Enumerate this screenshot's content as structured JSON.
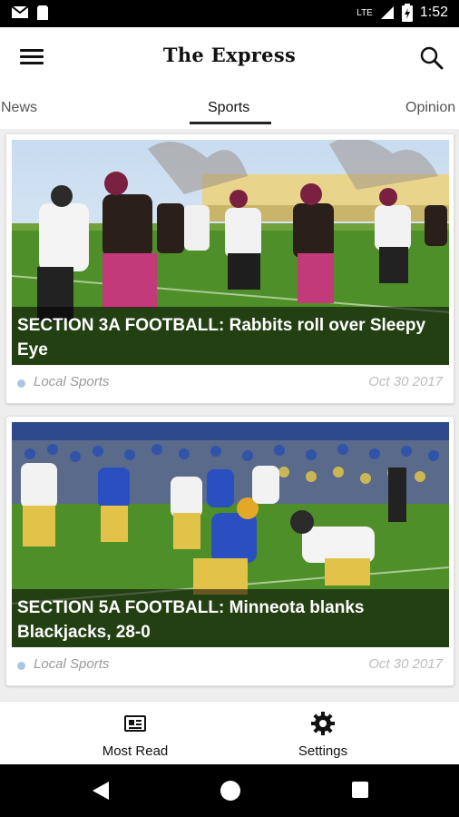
{
  "status_bar": {
    "time": "1:52",
    "network": "LTE",
    "icons": [
      "gmail-icon",
      "sim-icon",
      "signal-icon",
      "battery-icon"
    ]
  },
  "app_bar": {
    "title": "The Express",
    "menu_icon": "hamburger-menu-icon",
    "search_icon": "search-icon"
  },
  "tabs": [
    {
      "label": "News",
      "active": false
    },
    {
      "label": "Sports",
      "active": true
    },
    {
      "label": "Opinion",
      "active": false
    }
  ],
  "articles": [
    {
      "headline": "SECTION 3A FOOTBALL: Rabbits roll over Sleepy Eye",
      "category": "Local Sports",
      "date": "Oct 30 2017"
    },
    {
      "headline": "SECTION 5A FOOTBALL: Minneota blanks Blackjacks, 28-0",
      "category": "Local Sports",
      "date": "Oct 30 2017"
    }
  ],
  "bottom_nav": [
    {
      "label": "Most Read",
      "icon": "newspaper-icon"
    },
    {
      "label": "Settings",
      "icon": "gear-icon"
    }
  ],
  "system_nav": [
    "back-icon",
    "home-icon",
    "recents-icon"
  ],
  "colors": {
    "feed_background": "#eeeeee",
    "category_dot": "#a9c6e3",
    "grass": "#4f8f2a"
  }
}
